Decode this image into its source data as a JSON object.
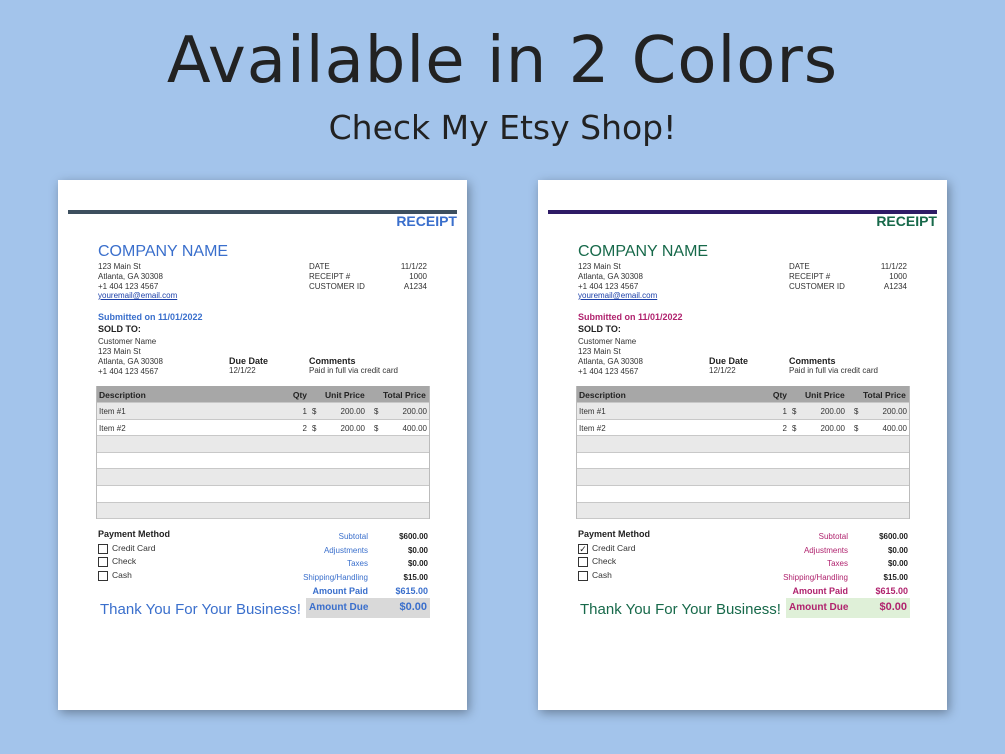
{
  "headline": "Available in 2 Colors",
  "subline": "Check My Etsy Shop!",
  "colors": {
    "blue_accent": "#3a6fcc",
    "green_accent": "#17694a",
    "magenta_accent": "#b0236e",
    "left_bar": "#3d4f5e",
    "right_bar": "#2e1b66",
    "left_due_box": "#d9d9d9",
    "right_due_box": "#dff0d8"
  },
  "receipt": {
    "title": "RECEIPT",
    "company_name": "COMPANY NAME",
    "address1": "123 Main St",
    "address2": "Atlanta, GA 30308",
    "phone": "+1 404 123 4567",
    "email": "youremail@email.com",
    "meta_labels": [
      "DATE",
      "RECEIPT #",
      "CUSTOMER ID"
    ],
    "meta_values": [
      "11/1/22",
      "1000",
      "A1234"
    ],
    "submitted": "Submitted on 11/01/2022",
    "sold_to": "SOLD TO:",
    "customer_name": "Customer Name",
    "customer_address1": "123 Main St",
    "customer_address2": "Atlanta, GA 30308",
    "customer_phone": "+1 404 123 4567",
    "due_date_label": "Due Date",
    "due_date": "12/1/22",
    "comments_label": "Comments",
    "comments": "Paid in full via credit card",
    "columns": [
      "Description",
      "Qty",
      "Unit Price",
      "Total Price"
    ],
    "currency": "$",
    "items": [
      {
        "description": "Item #1",
        "qty": "1",
        "unit_price": "200.00",
        "total": "200.00"
      },
      {
        "description": "Item #2",
        "qty": "2",
        "unit_price": "200.00",
        "total": "400.00"
      }
    ],
    "payment_method_title": "Payment Method",
    "payment_options": [
      "Credit Card",
      "Check",
      "Cash"
    ],
    "totals_labels": [
      "Subtotal",
      "Adjustments",
      "Taxes",
      "Shipping/Handling",
      "Amount Paid"
    ],
    "totals_values": [
      "$600.00",
      "$0.00",
      "$0.00",
      "$15.00",
      "$615.00"
    ],
    "thanks": "Thank You For Your Business!",
    "amount_due_label": "Amount Due",
    "amount_due": "$0.00"
  },
  "right_checked": "✓"
}
